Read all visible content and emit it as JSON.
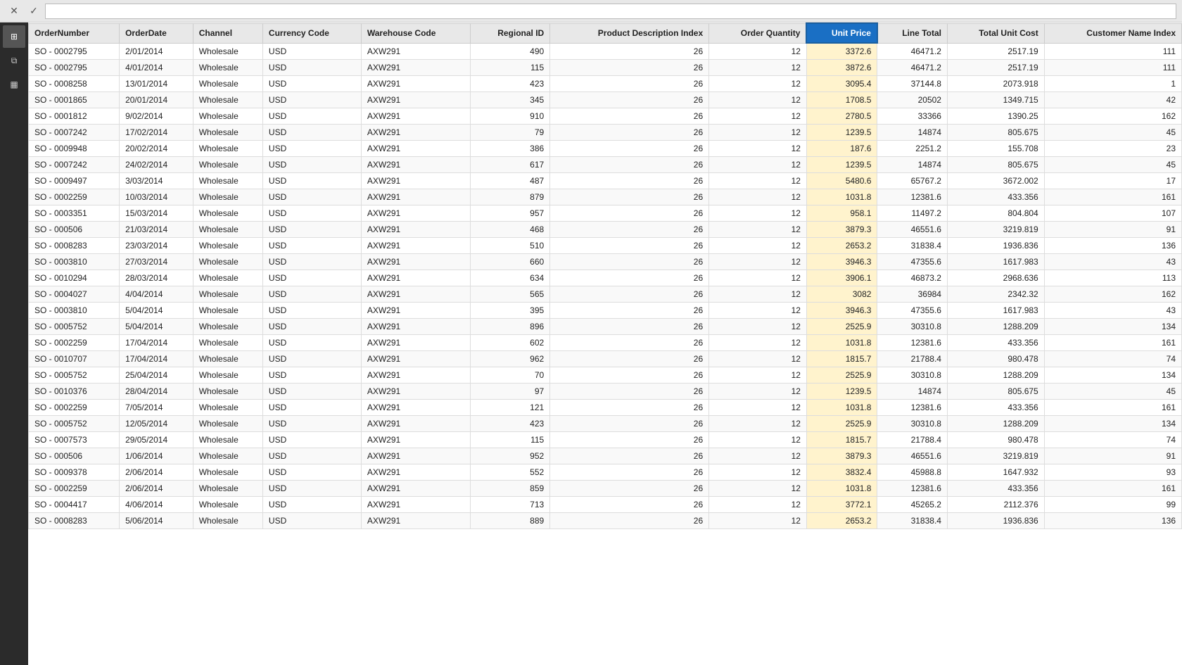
{
  "topbar": {
    "close_label": "✕",
    "check_label": "✓",
    "input_value": ""
  },
  "sidebar": {
    "icons": [
      {
        "name": "grid-icon",
        "symbol": "⊞"
      },
      {
        "name": "layers-icon",
        "symbol": "⧉"
      },
      {
        "name": "table-icon",
        "symbol": "▦"
      }
    ]
  },
  "table": {
    "columns": [
      {
        "key": "order_number",
        "label": "OrderNumber",
        "class": "col-order-number"
      },
      {
        "key": "order_date",
        "label": "OrderDate",
        "class": "col-order-date"
      },
      {
        "key": "channel",
        "label": "Channel",
        "class": "col-channel"
      },
      {
        "key": "currency_code",
        "label": "Currency Code",
        "class": "col-currency"
      },
      {
        "key": "warehouse_code",
        "label": "Warehouse Code",
        "class": "col-warehouse"
      },
      {
        "key": "regional_id",
        "label": "Regional ID",
        "class": "col-regional"
      },
      {
        "key": "product_desc",
        "label": "Product Description Index",
        "class": "col-product-desc"
      },
      {
        "key": "order_qty",
        "label": "Order Quantity",
        "class": "col-order-qty"
      },
      {
        "key": "unit_price",
        "label": "Unit Price",
        "class": "col-unit-price sorted"
      },
      {
        "key": "line_total",
        "label": "Line Total",
        "class": "col-line-total"
      },
      {
        "key": "total_unit_cost",
        "label": "Total Unit Cost",
        "class": "col-total-unit"
      },
      {
        "key": "customer_name_index",
        "label": "Customer Name Index",
        "class": "col-customer"
      }
    ],
    "rows": [
      {
        "order_number": "SO - 0002795",
        "order_date": "2/01/2014",
        "channel": "Wholesale",
        "currency_code": "USD",
        "warehouse_code": "AXW291",
        "regional_id": "490",
        "product_desc": "26",
        "order_qty": "12",
        "unit_price": "3372.6",
        "line_total": "46471.2",
        "total_unit_cost": "2517.19",
        "customer_name_index": "111"
      },
      {
        "order_number": "SO - 0002795",
        "order_date": "4/01/2014",
        "channel": "Wholesale",
        "currency_code": "USD",
        "warehouse_code": "AXW291",
        "regional_id": "115",
        "product_desc": "26",
        "order_qty": "12",
        "unit_price": "3872.6",
        "line_total": "46471.2",
        "total_unit_cost": "2517.19",
        "customer_name_index": "111"
      },
      {
        "order_number": "SO - 0008258",
        "order_date": "13/01/2014",
        "channel": "Wholesale",
        "currency_code": "USD",
        "warehouse_code": "AXW291",
        "regional_id": "423",
        "product_desc": "26",
        "order_qty": "12",
        "unit_price": "3095.4",
        "line_total": "37144.8",
        "total_unit_cost": "2073.918",
        "customer_name_index": "1"
      },
      {
        "order_number": "SO - 0001865",
        "order_date": "20/01/2014",
        "channel": "Wholesale",
        "currency_code": "USD",
        "warehouse_code": "AXW291",
        "regional_id": "345",
        "product_desc": "26",
        "order_qty": "12",
        "unit_price": "1708.5",
        "line_total": "20502",
        "total_unit_cost": "1349.715",
        "customer_name_index": "42"
      },
      {
        "order_number": "SO - 0001812",
        "order_date": "9/02/2014",
        "channel": "Wholesale",
        "currency_code": "USD",
        "warehouse_code": "AXW291",
        "regional_id": "910",
        "product_desc": "26",
        "order_qty": "12",
        "unit_price": "2780.5",
        "line_total": "33366",
        "total_unit_cost": "1390.25",
        "customer_name_index": "162"
      },
      {
        "order_number": "SO - 0007242",
        "order_date": "17/02/2014",
        "channel": "Wholesale",
        "currency_code": "USD",
        "warehouse_code": "AXW291",
        "regional_id": "79",
        "product_desc": "26",
        "order_qty": "12",
        "unit_price": "1239.5",
        "line_total": "14874",
        "total_unit_cost": "805.675",
        "customer_name_index": "45"
      },
      {
        "order_number": "SO - 0009948",
        "order_date": "20/02/2014",
        "channel": "Wholesale",
        "currency_code": "USD",
        "warehouse_code": "AXW291",
        "regional_id": "386",
        "product_desc": "26",
        "order_qty": "12",
        "unit_price": "187.6",
        "line_total": "2251.2",
        "total_unit_cost": "155.708",
        "customer_name_index": "23"
      },
      {
        "order_number": "SO - 0007242",
        "order_date": "24/02/2014",
        "channel": "Wholesale",
        "currency_code": "USD",
        "warehouse_code": "AXW291",
        "regional_id": "617",
        "product_desc": "26",
        "order_qty": "12",
        "unit_price": "1239.5",
        "line_total": "14874",
        "total_unit_cost": "805.675",
        "customer_name_index": "45"
      },
      {
        "order_number": "SO - 0009497",
        "order_date": "3/03/2014",
        "channel": "Wholesale",
        "currency_code": "USD",
        "warehouse_code": "AXW291",
        "regional_id": "487",
        "product_desc": "26",
        "order_qty": "12",
        "unit_price": "5480.6",
        "line_total": "65767.2",
        "total_unit_cost": "3672.002",
        "customer_name_index": "17"
      },
      {
        "order_number": "SO - 0002259",
        "order_date": "10/03/2014",
        "channel": "Wholesale",
        "currency_code": "USD",
        "warehouse_code": "AXW291",
        "regional_id": "879",
        "product_desc": "26",
        "order_qty": "12",
        "unit_price": "1031.8",
        "line_total": "12381.6",
        "total_unit_cost": "433.356",
        "customer_name_index": "161"
      },
      {
        "order_number": "SO - 0003351",
        "order_date": "15/03/2014",
        "channel": "Wholesale",
        "currency_code": "USD",
        "warehouse_code": "AXW291",
        "regional_id": "957",
        "product_desc": "26",
        "order_qty": "12",
        "unit_price": "958.1",
        "line_total": "11497.2",
        "total_unit_cost": "804.804",
        "customer_name_index": "107"
      },
      {
        "order_number": "SO - 000506",
        "order_date": "21/03/2014",
        "channel": "Wholesale",
        "currency_code": "USD",
        "warehouse_code": "AXW291",
        "regional_id": "468",
        "product_desc": "26",
        "order_qty": "12",
        "unit_price": "3879.3",
        "line_total": "46551.6",
        "total_unit_cost": "3219.819",
        "customer_name_index": "91"
      },
      {
        "order_number": "SO - 0008283",
        "order_date": "23/03/2014",
        "channel": "Wholesale",
        "currency_code": "USD",
        "warehouse_code": "AXW291",
        "regional_id": "510",
        "product_desc": "26",
        "order_qty": "12",
        "unit_price": "2653.2",
        "line_total": "31838.4",
        "total_unit_cost": "1936.836",
        "customer_name_index": "136"
      },
      {
        "order_number": "SO - 0003810",
        "order_date": "27/03/2014",
        "channel": "Wholesale",
        "currency_code": "USD",
        "warehouse_code": "AXW291",
        "regional_id": "660",
        "product_desc": "26",
        "order_qty": "12",
        "unit_price": "3946.3",
        "line_total": "47355.6",
        "total_unit_cost": "1617.983",
        "customer_name_index": "43"
      },
      {
        "order_number": "SO - 0010294",
        "order_date": "28/03/2014",
        "channel": "Wholesale",
        "currency_code": "USD",
        "warehouse_code": "AXW291",
        "regional_id": "634",
        "product_desc": "26",
        "order_qty": "12",
        "unit_price": "3906.1",
        "line_total": "46873.2",
        "total_unit_cost": "2968.636",
        "customer_name_index": "113"
      },
      {
        "order_number": "SO - 0004027",
        "order_date": "4/04/2014",
        "channel": "Wholesale",
        "currency_code": "USD",
        "warehouse_code": "AXW291",
        "regional_id": "565",
        "product_desc": "26",
        "order_qty": "12",
        "unit_price": "3082",
        "line_total": "36984",
        "total_unit_cost": "2342.32",
        "customer_name_index": "162"
      },
      {
        "order_number": "SO - 0003810",
        "order_date": "5/04/2014",
        "channel": "Wholesale",
        "currency_code": "USD",
        "warehouse_code": "AXW291",
        "regional_id": "395",
        "product_desc": "26",
        "order_qty": "12",
        "unit_price": "3946.3",
        "line_total": "47355.6",
        "total_unit_cost": "1617.983",
        "customer_name_index": "43"
      },
      {
        "order_number": "SO - 0005752",
        "order_date": "5/04/2014",
        "channel": "Wholesale",
        "currency_code": "USD",
        "warehouse_code": "AXW291",
        "regional_id": "896",
        "product_desc": "26",
        "order_qty": "12",
        "unit_price": "2525.9",
        "line_total": "30310.8",
        "total_unit_cost": "1288.209",
        "customer_name_index": "134"
      },
      {
        "order_number": "SO - 0002259",
        "order_date": "17/04/2014",
        "channel": "Wholesale",
        "currency_code": "USD",
        "warehouse_code": "AXW291",
        "regional_id": "602",
        "product_desc": "26",
        "order_qty": "12",
        "unit_price": "1031.8",
        "line_total": "12381.6",
        "total_unit_cost": "433.356",
        "customer_name_index": "161"
      },
      {
        "order_number": "SO - 0010707",
        "order_date": "17/04/2014",
        "channel": "Wholesale",
        "currency_code": "USD",
        "warehouse_code": "AXW291",
        "regional_id": "962",
        "product_desc": "26",
        "order_qty": "12",
        "unit_price": "1815.7",
        "line_total": "21788.4",
        "total_unit_cost": "980.478",
        "customer_name_index": "74"
      },
      {
        "order_number": "SO - 0005752",
        "order_date": "25/04/2014",
        "channel": "Wholesale",
        "currency_code": "USD",
        "warehouse_code": "AXW291",
        "regional_id": "70",
        "product_desc": "26",
        "order_qty": "12",
        "unit_price": "2525.9",
        "line_total": "30310.8",
        "total_unit_cost": "1288.209",
        "customer_name_index": "134"
      },
      {
        "order_number": "SO - 0010376",
        "order_date": "28/04/2014",
        "channel": "Wholesale",
        "currency_code": "USD",
        "warehouse_code": "AXW291",
        "regional_id": "97",
        "product_desc": "26",
        "order_qty": "12",
        "unit_price": "1239.5",
        "line_total": "14874",
        "total_unit_cost": "805.675",
        "customer_name_index": "45"
      },
      {
        "order_number": "SO - 0002259",
        "order_date": "7/05/2014",
        "channel": "Wholesale",
        "currency_code": "USD",
        "warehouse_code": "AXW291",
        "regional_id": "121",
        "product_desc": "26",
        "order_qty": "12",
        "unit_price": "1031.8",
        "line_total": "12381.6",
        "total_unit_cost": "433.356",
        "customer_name_index": "161"
      },
      {
        "order_number": "SO - 0005752",
        "order_date": "12/05/2014",
        "channel": "Wholesale",
        "currency_code": "USD",
        "warehouse_code": "AXW291",
        "regional_id": "423",
        "product_desc": "26",
        "order_qty": "12",
        "unit_price": "2525.9",
        "line_total": "30310.8",
        "total_unit_cost": "1288.209",
        "customer_name_index": "134"
      },
      {
        "order_number": "SO - 0007573",
        "order_date": "29/05/2014",
        "channel": "Wholesale",
        "currency_code": "USD",
        "warehouse_code": "AXW291",
        "regional_id": "115",
        "product_desc": "26",
        "order_qty": "12",
        "unit_price": "1815.7",
        "line_total": "21788.4",
        "total_unit_cost": "980.478",
        "customer_name_index": "74"
      },
      {
        "order_number": "SO - 000506",
        "order_date": "1/06/2014",
        "channel": "Wholesale",
        "currency_code": "USD",
        "warehouse_code": "AXW291",
        "regional_id": "952",
        "product_desc": "26",
        "order_qty": "12",
        "unit_price": "3879.3",
        "line_total": "46551.6",
        "total_unit_cost": "3219.819",
        "customer_name_index": "91"
      },
      {
        "order_number": "SO - 0009378",
        "order_date": "2/06/2014",
        "channel": "Wholesale",
        "currency_code": "USD",
        "warehouse_code": "AXW291",
        "regional_id": "552",
        "product_desc": "26",
        "order_qty": "12",
        "unit_price": "3832.4",
        "line_total": "45988.8",
        "total_unit_cost": "1647.932",
        "customer_name_index": "93"
      },
      {
        "order_number": "SO - 0002259",
        "order_date": "2/06/2014",
        "channel": "Wholesale",
        "currency_code": "USD",
        "warehouse_code": "AXW291",
        "regional_id": "859",
        "product_desc": "26",
        "order_qty": "12",
        "unit_price": "1031.8",
        "line_total": "12381.6",
        "total_unit_cost": "433.356",
        "customer_name_index": "161"
      },
      {
        "order_number": "SO - 0004417",
        "order_date": "4/06/2014",
        "channel": "Wholesale",
        "currency_code": "USD",
        "warehouse_code": "AXW291",
        "regional_id": "713",
        "product_desc": "26",
        "order_qty": "12",
        "unit_price": "3772.1",
        "line_total": "45265.2",
        "total_unit_cost": "2112.376",
        "customer_name_index": "99"
      },
      {
        "order_number": "SO - 0008283",
        "order_date": "5/06/2014",
        "channel": "Wholesale",
        "currency_code": "USD",
        "warehouse_code": "AXW291",
        "regional_id": "889",
        "product_desc": "26",
        "order_qty": "12",
        "unit_price": "2653.2",
        "line_total": "31838.4",
        "total_unit_cost": "1936.836",
        "customer_name_index": "136"
      }
    ]
  }
}
